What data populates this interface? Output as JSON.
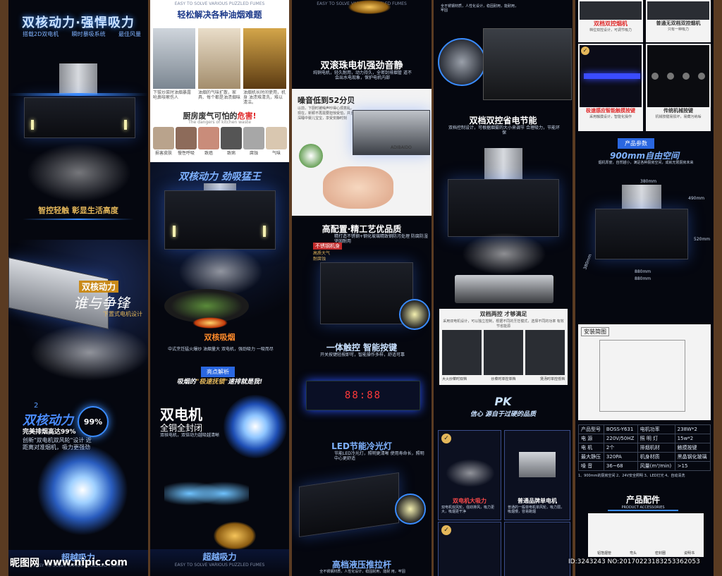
{
  "colors": {
    "accent_blue": "#3a8cff",
    "warm_gold": "#e4b75a",
    "alert_red": "#e02a2a"
  },
  "col1": {
    "title": "双核动力·强悍吸力",
    "features": [
      "搭载2D双电机",
      "瞬时暴吸系统",
      "最佳风量"
    ],
    "tagline": "智控轻触 彰显生活高度",
    "battle_title": "双核动力",
    "battle_sub": "谁与争锋",
    "battle_note": "下置式电机设计",
    "badge_num": "2",
    "power_title": "双核动力",
    "percent": "99%",
    "power_desc": "完美排烟高达99%",
    "power_small": "创新\"双电机双风轮\"设计 近距离对准烟机，吸力更强劲",
    "bottom_banner": "超越吸力",
    "bottom_sub": "EASY TO SOLVE VARIOUS PUZZLED FUMES"
  },
  "col2": {
    "top_sub": "EASY TO SOLVE VARIOUS PUZZLED FUMES",
    "title": "轻松解决各种油烟难题",
    "cap1": "下拔炒菜时油烟暴露 呛鼻咳嗽伤人",
    "cap2": "油烟的气味扩散，家 具、每个都是油渍烟味",
    "cap3": "油烟机长时间使用，机身 油渍难清洗，难以清洁。",
    "danger_title_a": "厨房废气可怕的",
    "danger_title_b": "危害!",
    "danger_sub": "The dangers of kitchen waste",
    "danger_caps": [
      "损害皮肤",
      "慢性呼吸",
      "致癌",
      "致病",
      "腐蚀",
      "气味"
    ],
    "motor_title": "双核动力 劲吸猛王",
    "fire_caption": "双核吸烟",
    "fire_small": "中式烹饪猛火爆炒 油烟量大 双电机，强劲吸力 一吸而尽",
    "section_badge": "亮点解析",
    "slogan_a": "吸烟的",
    "slogan_b": "\"极速抚锁\"",
    "slogan_c": "速排就是我!",
    "dual_motor": "双电机",
    "sealed": "全铜全封闭",
    "sealed_desc": "双核电机，双倍动力越吸越清晰",
    "bottom_banner": "超越吸力",
    "bottom_sub": "EASY TO SOLVE VARIOUS PUZZLED FUMES"
  },
  "col3": {
    "top_text": "EASY TO SOLVE VARIOUS PUZZLED FUMES",
    "bearing_title": "双滚珠电机强劲音静",
    "bearing_desc": "纯铜电机，轻久耐用，动力持久，全密封排烟管 道不会出水电现象，保护电机内部",
    "noise_title": "噪音低到52分贝",
    "noise_desc": "以前，下厨时被噪声吵得心烦意乱。现在，新颖不再需要担惊受怕，并且深睡中婴儿宝宝，享受安静时刻",
    "brand": "ADIBAIDO",
    "config_title": "高配置·精工艺优品质",
    "config_desc": "精打造不锈钢+钢化玻璃精致钢防污处理 防腐防湿 坚固耐用",
    "steel_label": "不锈钢机身",
    "steel_note": "高质大气",
    "steel_note2": "耐腐蚀",
    "touch_title": "一体触控 智能按键",
    "touch_desc": "开关按键轻按即可，智能操作多样，舒适可靠",
    "display": "88:88",
    "led_title": "LED节能冷光灯",
    "led_desc": "节能LED冷光灯，照明更清晰 使用寿命长，照明中心更舒适",
    "valve_title": "高档液压推拉杆",
    "valve_desc": "全不锈钢材质，人性化设计，稳固耐用，能耐 用，牢固"
  },
  "col4": {
    "top_text": "全不锈钢材质，人性化设计，稳固耐用，能耐用，牢固",
    "dual_control_title": "双档双控省电节能",
    "dual_control_desc": "双档控制设计，可根据烟雾的大小来调节 合理吸力，节能环保",
    "mode_title": "双档两控 才够满足",
    "mode_desc": "采用双电机设计，可以独立控制，根据不同的烹饪模式，选择不同的功率 有效节省能源",
    "mode_caps": [
      "大火炒菜时双档",
      "炒菜时单控单档",
      "煲汤时单控低档"
    ],
    "pk": "PK",
    "pk_tag": "信心 源自于过硬的品质",
    "card1_title": "双电机大吸力",
    "card1_desc": "双电机双风轮，强劲排风，吸力更大，吸烟更干净",
    "card2_title": "普通品牌单电机",
    "card2_desc": "普通的一般单电机单风轮，吸力弱，吸烟慢，容易跑烟"
  },
  "col5": {
    "red_left": "双档双控烟机",
    "red_left_desc": "档位双控设计，可调节吸力",
    "red_right": "普通无双档双控烟机",
    "red_right_desc": "只有一种吸力",
    "touch_red": "极速感应智能触摸按键",
    "touch_red_desc": "采用触摸设计，智能化操作",
    "mech_red": "传统机械按键",
    "mech_red_desc": "机械按键易损坏，易藏污纳垢",
    "param_badge": "产品参数",
    "space_title": "900mm自由空间",
    "space_desc": "烟机厚度，自然越小，满足各种厨房空间，成就无限厨房未来",
    "dim_top": "380mm",
    "dim_h1": "490mm",
    "dim_h2": "520mm",
    "dim_w1": "880mm",
    "dim_w2": "880mm",
    "dim_d": "380mm",
    "install_title": "安装简图",
    "table_rows": [
      [
        "产品型号",
        "BOSS-Y631",
        "电机功率",
        "238W*2"
      ],
      [
        "电 源",
        "220V/50HZ",
        "照 明 灯",
        "15w*2"
      ],
      [
        "电 机",
        "2个",
        "排烟机材",
        "触摸按键"
      ],
      [
        "最大静压",
        "320PA",
        "机身材质",
        "黑晶钢化玻璃"
      ],
      [
        "噪 音",
        "36~68",
        "风量(m³/min)",
        ">15"
      ]
    ],
    "table_note": "1、900mm的厨房空间 2、24V安全照明 3、LED灯光 4、自动清洗",
    "accessory_title": "产品配件",
    "accessory_sub": "PRODUCT ACCESSORIES",
    "accessory_caps": [
      "铝箔烟管",
      "弯头",
      "密封圈",
      "说明书"
    ]
  },
  "watermark": {
    "logo": "昵图网",
    "url": "www.nipic.com",
    "id": "ID:3243243 NO:20170223183253362053"
  }
}
